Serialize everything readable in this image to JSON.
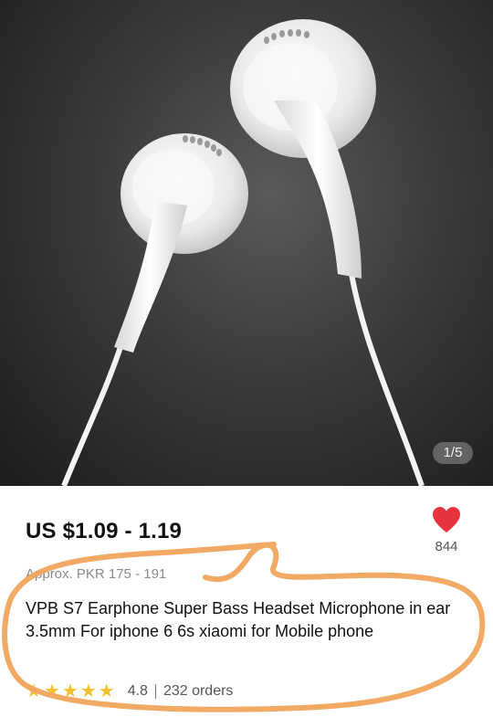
{
  "product_image": {
    "counter": "1/5"
  },
  "product": {
    "price": "US $1.09 - 1.19",
    "approx_price": "Approx. PKR 175 - 191",
    "title": "VPB S7 Earphone Super Bass Headset Microphone in ear 3.5mm For iphone 6 6s xiaomi for Mobile phone",
    "rating": "4.8",
    "orders": "232 orders",
    "stars_filled": 5,
    "wishlist_count": "844"
  },
  "colors": {
    "price_text": "#111111",
    "heart": "#e8323c",
    "star": "#f2c12e",
    "annotation": "#f0a45c"
  },
  "icons": {
    "wishlist": "heart-icon",
    "rating": "star-icon"
  }
}
